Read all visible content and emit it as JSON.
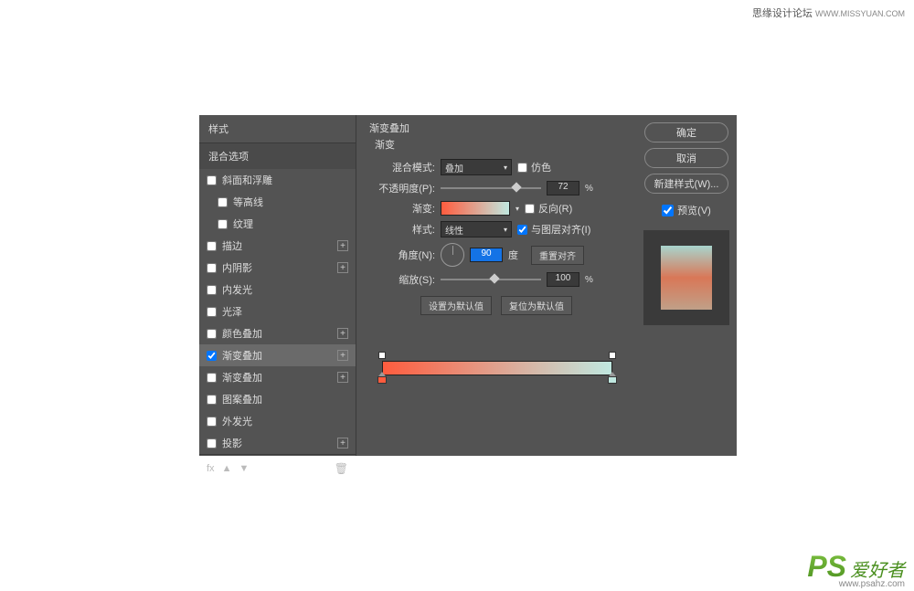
{
  "watermarks": {
    "top": "思缘设计论坛",
    "top_url": "WWW.MISSYUAN.COM",
    "bottom_ps": "PS",
    "bottom_cn": "爱好者",
    "bottom_url": "www.psahz.com"
  },
  "styles_panel": {
    "header": "样式",
    "blend_options": "混合选项",
    "items": [
      {
        "label": "斜面和浮雕",
        "checked": false,
        "plus": false,
        "indent": false
      },
      {
        "label": "等高线",
        "checked": false,
        "plus": false,
        "indent": true
      },
      {
        "label": "纹理",
        "checked": false,
        "plus": false,
        "indent": true
      },
      {
        "label": "描边",
        "checked": false,
        "plus": true,
        "indent": false
      },
      {
        "label": "内阴影",
        "checked": false,
        "plus": true,
        "indent": false
      },
      {
        "label": "内发光",
        "checked": false,
        "plus": false,
        "indent": false
      },
      {
        "label": "光泽",
        "checked": false,
        "plus": false,
        "indent": false
      },
      {
        "label": "颜色叠加",
        "checked": false,
        "plus": true,
        "indent": false
      },
      {
        "label": "渐变叠加",
        "checked": true,
        "plus": true,
        "indent": false,
        "selected": true
      },
      {
        "label": "渐变叠加",
        "checked": false,
        "plus": true,
        "indent": false
      },
      {
        "label": "图案叠加",
        "checked": false,
        "plus": false,
        "indent": false
      },
      {
        "label": "外发光",
        "checked": false,
        "plus": false,
        "indent": false
      },
      {
        "label": "投影",
        "checked": false,
        "plus": true,
        "indent": false
      }
    ],
    "footer_fx": "fx"
  },
  "gradient_overlay": {
    "title": "渐变叠加",
    "sub": "渐变",
    "blend_mode_label": "混合模式:",
    "blend_mode_value": "叠加",
    "dither_label": "仿色",
    "dither_checked": false,
    "opacity_label": "不透明度(P):",
    "opacity_value": "72",
    "pct": "%",
    "gradient_label": "渐变:",
    "reverse_label": "反向(R)",
    "reverse_checked": false,
    "style_label": "样式:",
    "style_value": "线性",
    "align_label": "与图层对齐(I)",
    "align_checked": true,
    "angle_label": "角度(N):",
    "angle_value": "90",
    "angle_unit": "度",
    "reset_align": "重置对齐",
    "scale_label": "缩放(S):",
    "scale_value": "100",
    "set_default": "设置为默认值",
    "reset_default": "复位为默认值"
  },
  "buttons": {
    "ok": "确定",
    "cancel": "取消",
    "new_style": "新建样式(W)...",
    "preview": "预览(V)",
    "preview_checked": true
  }
}
